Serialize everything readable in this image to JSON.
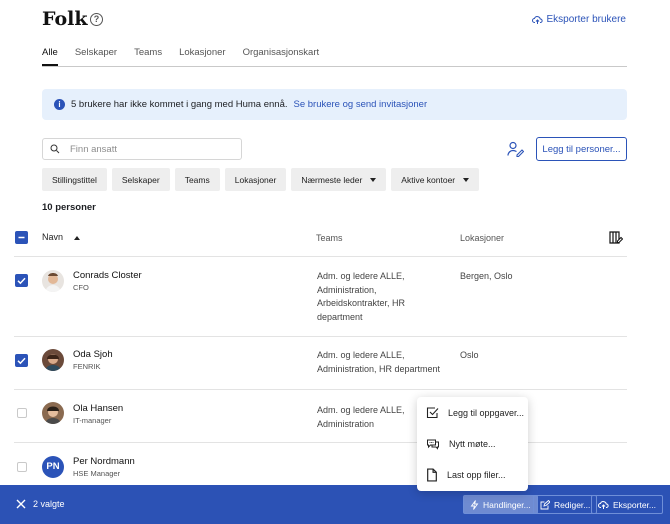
{
  "header": {
    "title": "Folk",
    "help": "?",
    "export_label": "Eksporter brukere"
  },
  "tabs": [
    {
      "label": "Alle",
      "active": true
    },
    {
      "label": "Selskaper"
    },
    {
      "label": "Teams"
    },
    {
      "label": "Lokasjoner"
    },
    {
      "label": "Organisasjonskart"
    }
  ],
  "banner": {
    "icon": "i",
    "text": "5 brukere har ikke kommet i gang med Huma ennå.",
    "link": "Se brukere og send invitasjoner"
  },
  "search": {
    "placeholder": "Finn ansatt",
    "value": ""
  },
  "add_button": "Legg til personer...",
  "filters": [
    {
      "label": "Stillingstittel"
    },
    {
      "label": "Selskaper"
    },
    {
      "label": "Teams"
    },
    {
      "label": "Lokasjoner"
    },
    {
      "label": "Nærmeste leder",
      "dropdown": true
    },
    {
      "label": "Aktive kontoer",
      "dropdown": true
    }
  ],
  "count": "10 personer",
  "table": {
    "headers": {
      "name": "Navn",
      "teams": "Teams",
      "locations": "Lokasjoner"
    },
    "rows": [
      {
        "name": "Conrads Closter",
        "role": "CFO",
        "teams": "Adm. og ledere ALLE, Administration, Arbeidskontrakter, HR department",
        "location": "Bergen, Oslo",
        "checked": true,
        "avatar": "photo"
      },
      {
        "name": "Oda Sjoh",
        "role": "FENRIK",
        "teams": "Adm. og ledere ALLE, Administration, HR department",
        "location": "Oslo",
        "checked": true,
        "avatar": "photo"
      },
      {
        "name": "Ola Hansen",
        "role": "IT-manager",
        "teams": "Adm. og ledere ALLE, Administration",
        "location": "",
        "checked": false,
        "avatar": "photo"
      },
      {
        "name": "Per Nordmann",
        "role": "HSE Manager",
        "teams": "",
        "location": "",
        "checked": false,
        "avatar": "initials",
        "initials": "PN"
      }
    ]
  },
  "menu": [
    {
      "label": "Legg til oppgaver...",
      "icon": "checkbox-icon"
    },
    {
      "label": "Nytt møte...",
      "icon": "chat-icon"
    },
    {
      "label": "Last opp filer...",
      "icon": "file-icon"
    }
  ],
  "bottom_bar": {
    "selected": "2 valgte",
    "actions_label": "Handlinger...",
    "edit_label": "Rediger...",
    "export_label": "Eksporter..."
  },
  "colors": {
    "accent": "#2b53b8",
    "bar": "#2c52b5",
    "banner_bg": "#e6f0fc"
  }
}
